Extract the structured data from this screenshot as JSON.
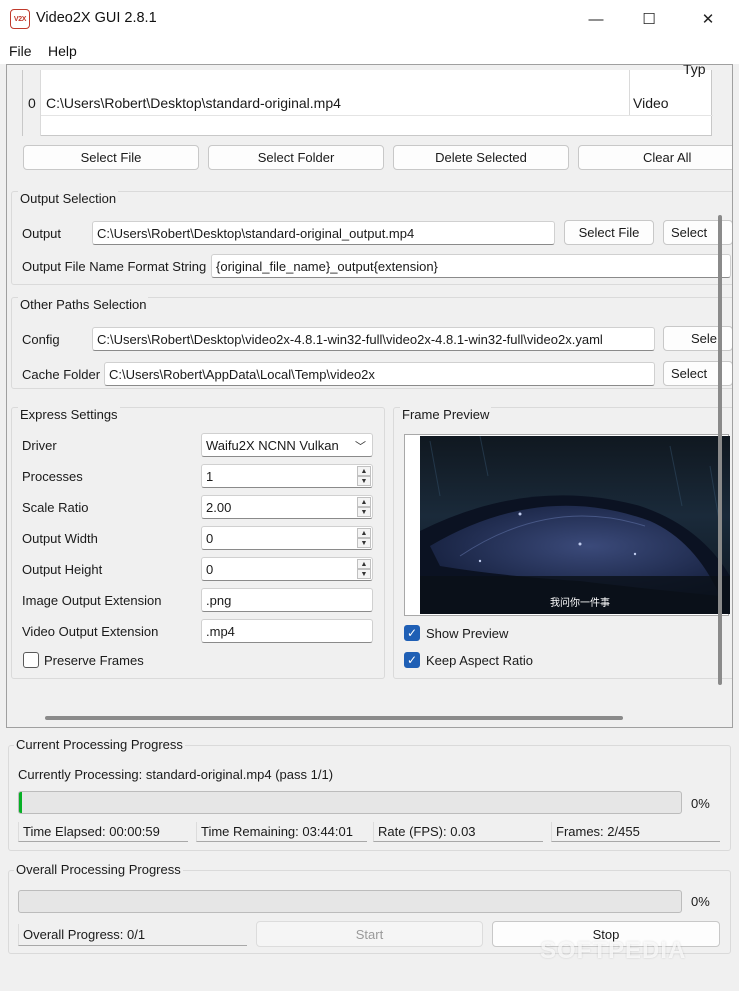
{
  "window": {
    "title": "Video2X GUI 2.8.1",
    "icon_text": "V2X"
  },
  "window_controls": {
    "minimize": "—",
    "maximize": "☐",
    "close": "✕"
  },
  "menu": {
    "file": "File",
    "help": "Help"
  },
  "input_table": {
    "header_partial": "Typ",
    "rows": [
      {
        "index": "0",
        "path": "C:\\Users\\Robert\\Desktop\\standard-original.mp4",
        "type": "Video"
      }
    ]
  },
  "input_buttons": {
    "select_file": "Select File",
    "select_folder": "Select Folder",
    "delete_selected": "Delete Selected",
    "clear_all": "Clear All"
  },
  "output_selection": {
    "title": "Output Selection",
    "output_label": "Output",
    "output_value": "C:\\Users\\Robert\\Desktop\\standard-original_output.mp4",
    "select_file": "Select File",
    "select_folder": "Select",
    "format_label": "Output File Name Format String",
    "format_value": "{original_file_name}_output{extension}"
  },
  "other_paths": {
    "title": "Other Paths Selection",
    "config_label": "Config",
    "config_value": "C:\\Users\\Robert\\Desktop\\video2x-4.8.1-win32-full\\video2x-4.8.1-win32-full\\video2x.yaml",
    "config_select": "Sele",
    "cache_label": "Cache Folder",
    "cache_value": "C:\\Users\\Robert\\AppData\\Local\\Temp\\video2x",
    "cache_select": "Select"
  },
  "express": {
    "title": "Express Settings",
    "driver_label": "Driver",
    "driver_value": "Waifu2X NCNN Vulkan",
    "processes_label": "Processes",
    "processes_value": "1",
    "scale_label": "Scale Ratio",
    "scale_value": "2.00",
    "width_label": "Output Width",
    "width_value": "0",
    "height_label": "Output Height",
    "height_value": "0",
    "image_ext_label": "Image Output Extension",
    "image_ext_value": ".png",
    "video_ext_label": "Video Output Extension",
    "video_ext_value": ".mp4",
    "preserve_label": "Preserve Frames",
    "preserve_checked": false
  },
  "preview": {
    "title": "Frame Preview",
    "subtitle": "我问你一件事",
    "show_label": "Show Preview",
    "show_checked": true,
    "aspect_label": "Keep Aspect Ratio",
    "aspect_checked": true
  },
  "current_progress": {
    "title": "Current Processing Progress",
    "status": "Currently Processing: standard-original.mp4 (pass 1/1)",
    "percent_text": "0%",
    "fill_fraction": 0.004,
    "elapsed": "Time Elapsed: 00:00:59",
    "remaining": "Time Remaining: 03:44:01",
    "rate": "Rate (FPS): 0.03",
    "frames": "Frames: 2/455"
  },
  "overall_progress": {
    "title": "Overall Processing Progress",
    "percent_text": "0%",
    "fill_fraction": 0,
    "status": "Overall Progress: 0/1",
    "start": "Start",
    "stop": "Stop"
  },
  "watermark": "SOFTPEDIA",
  "colors": {
    "accent": "#1f5fb5",
    "progress": "#06b025"
  }
}
